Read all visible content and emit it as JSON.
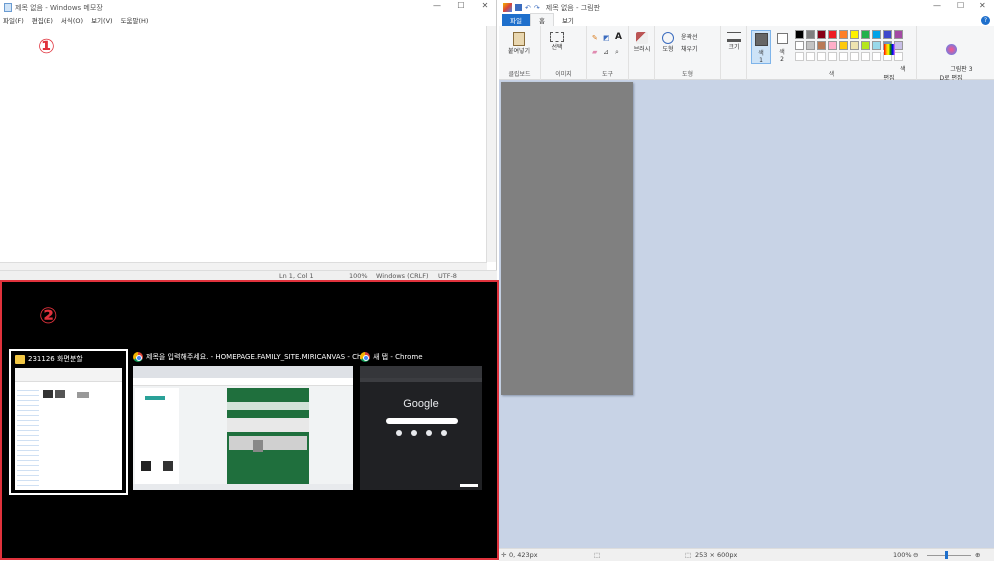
{
  "notepad": {
    "title": "제목 없음 - Windows 메모장",
    "menu": [
      "파일(F)",
      "편집(E)",
      "서식(O)",
      "보기(V)",
      "도움말(H)"
    ],
    "annotation": "①",
    "status": {
      "position": "Ln 1, Col 1",
      "zoom": "100%",
      "line_ending": "Windows (CRLF)",
      "encoding": "UTF-8"
    },
    "controls": {
      "minimize": "—",
      "maximize": "☐",
      "close": "✕"
    }
  },
  "task_switcher": {
    "annotation": "②",
    "windows": [
      {
        "title": "231126 화면분할",
        "app": "file-explorer"
      },
      {
        "title": "제목을 입력해주세요. - HOMEPAGE.FAMILY_SITE.MIRICANVAS - Chr...",
        "app": "chrome"
      },
      {
        "title": "새 탭 - Chrome",
        "app": "chrome"
      }
    ],
    "google_logo": "Google"
  },
  "paint": {
    "title": "제목 없음 - 그림판",
    "tabs": [
      "파일",
      "홈",
      "보기"
    ],
    "ribbon": {
      "clipboard": {
        "label": "클립보드",
        "paste": "붙여넣기"
      },
      "image": {
        "label": "이미지",
        "select": "선택"
      },
      "tools": {
        "label": "도구"
      },
      "brushes": "브러시",
      "shapes": {
        "label": "도형",
        "button": "도형",
        "outline": "윤곽선",
        "fill": "채우기"
      },
      "size": "크기",
      "color1": "색\n1",
      "color2": "색\n2",
      "colors_label": "색",
      "edit_colors": "색\n편집",
      "paint3d": "그림판 3\nD로 편집"
    },
    "palette": [
      "#000000",
      "#7f7f7f",
      "#880015",
      "#ed1c24",
      "#ff7f27",
      "#fff200",
      "#22b14c",
      "#00a2e8",
      "#3f48cc",
      "#a349a4",
      "#ffffff",
      "#c3c3c3",
      "#b97a57",
      "#ffaec9",
      "#ffc90e",
      "#efe4b0",
      "#b5e61d",
      "#99d9ea",
      "#7092be",
      "#c8bfe7"
    ],
    "status": {
      "cursor": "0, 423px",
      "size": "253 × 600px",
      "zoom": "100%"
    },
    "controls": {
      "minimize": "—",
      "maximize": "☐",
      "close": "✕"
    }
  }
}
